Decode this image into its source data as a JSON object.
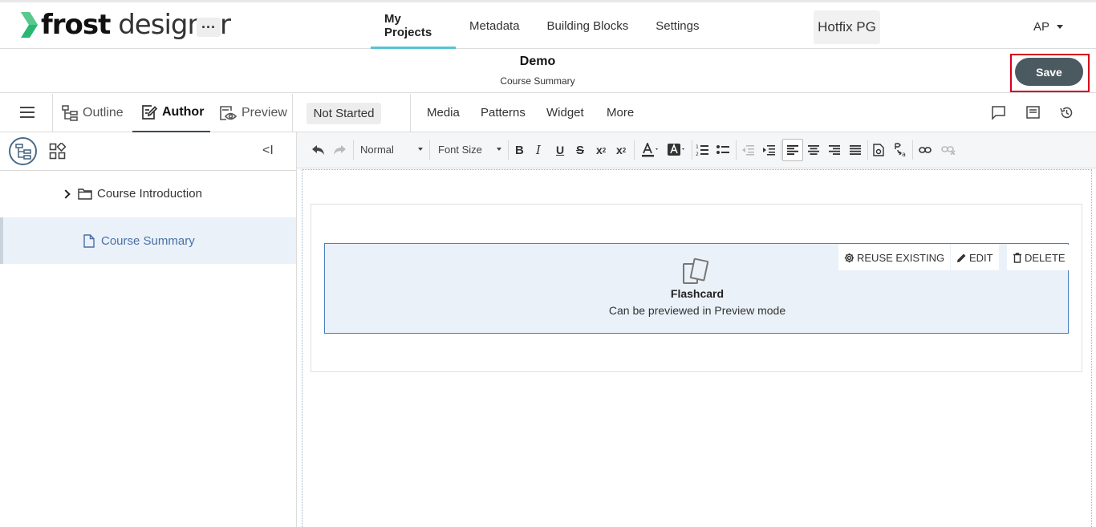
{
  "app": {
    "logo_bold": "frost",
    "logo_light": " designer",
    "more_label": "···"
  },
  "nav": {
    "items": [
      {
        "label": "My Projects",
        "active": true
      },
      {
        "label": "Metadata"
      },
      {
        "label": "Building Blocks"
      },
      {
        "label": "Settings"
      }
    ],
    "workspace": "Hotfix PG",
    "user": "AP"
  },
  "titlebar": {
    "title": "Demo",
    "subtitle": "Course Summary",
    "save_label": "Save"
  },
  "modes": {
    "outline": "Outline",
    "author": "Author",
    "preview": "Preview",
    "status": "Not Started",
    "menu": [
      "Media",
      "Patterns",
      "Widget",
      "More"
    ]
  },
  "tree": {
    "collapse_label": "<I",
    "items": [
      {
        "label": "Course Introduction",
        "type": "folder"
      },
      {
        "label": "Course Summary",
        "type": "page",
        "selected": true
      }
    ]
  },
  "editor_toolbar": {
    "format_value": "Normal",
    "font_size_value": "Font Size",
    "active_alignment": "left"
  },
  "widget": {
    "reuse_label": "REUSE EXISTING",
    "edit_label": "EDIT",
    "delete_label": "DELETE",
    "title": "Flashcard",
    "subtitle": "Can be previewed in Preview mode"
  },
  "colors": {
    "accent": "#58c3d6",
    "logo_green": "#2bb673",
    "save_bg": "#4b5a60",
    "highlight_outline": "#d6001c",
    "selected_bg": "#eaf1f8",
    "selected_text": "#4a6fa5",
    "widget_border": "#4a7fbf"
  }
}
